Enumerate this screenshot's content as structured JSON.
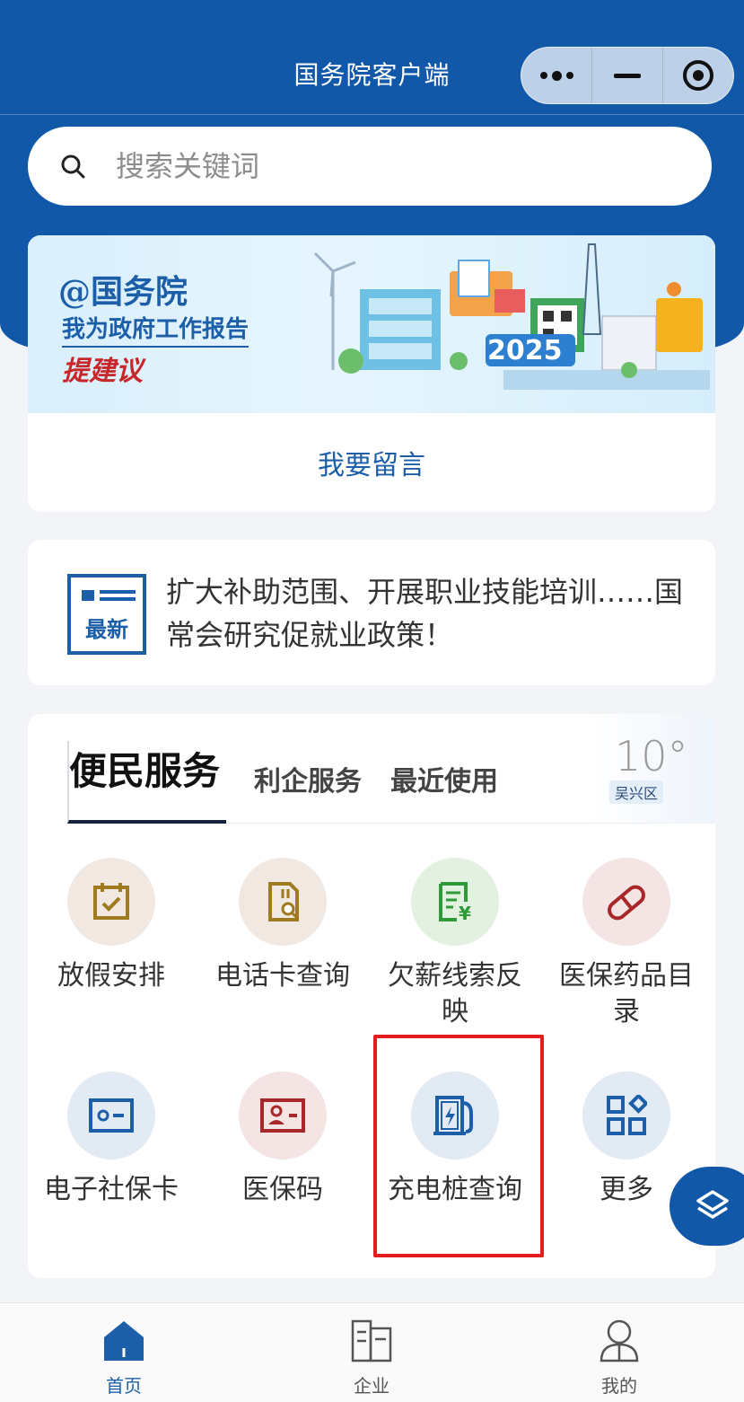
{
  "app": {
    "title": "国务院客户端"
  },
  "search": {
    "placeholder": "搜索关键词"
  },
  "banner": {
    "line1": "@国务院",
    "line2": "我为政府工作报告",
    "line3": "提建议",
    "year": "2025",
    "action_label": "我要留言"
  },
  "news": {
    "badge": "最新",
    "text": "扩大补助范围、开展职业技能培训……国常会研究促就业政策！"
  },
  "services": {
    "tabs": [
      {
        "label": "便民服务",
        "active": true
      },
      {
        "label": "利企服务",
        "active": false
      },
      {
        "label": "最近使用",
        "active": false
      }
    ],
    "weather": {
      "temperature": "10°",
      "district": "吴兴区"
    },
    "items": [
      {
        "label": "放假安排",
        "icon": "calendar-check-icon",
        "color": "#a07a1e",
        "bg": "#f1e8e2"
      },
      {
        "label": "电话卡查询",
        "icon": "sim-card-search-icon",
        "color": "#a07a1e",
        "bg": "#f1e8e2"
      },
      {
        "label": "欠薪线索反映",
        "icon": "receipt-yuan-icon",
        "color": "#2e9a3a",
        "bg": "#e3f1e1"
      },
      {
        "label": "医保药品目录",
        "icon": "pill-icon",
        "color": "#a8282a",
        "bg": "#f4e4e4"
      },
      {
        "label": "电子社保卡",
        "icon": "id-card-icon",
        "color": "#1c5fa8",
        "bg": "#e2eaf3"
      },
      {
        "label": "医保码",
        "icon": "person-card-icon",
        "color": "#a8282a",
        "bg": "#f4e4e4"
      },
      {
        "label": "充电桩查询",
        "icon": "charging-station-icon",
        "color": "#1c5fa8",
        "bg": "#e2eaf3"
      },
      {
        "label": "更多",
        "icon": "grid-more-icon",
        "color": "#1c5fa8",
        "bg": "#e2eaf3"
      }
    ]
  },
  "bottom_nav": [
    {
      "label": "首页",
      "icon": "home-icon",
      "active": true
    },
    {
      "label": "企业",
      "icon": "building-icon",
      "active": false
    },
    {
      "label": "我的",
      "icon": "user-icon",
      "active": false
    }
  ],
  "colors": {
    "primary": "#1158a8",
    "highlight": "#e31e1e"
  }
}
